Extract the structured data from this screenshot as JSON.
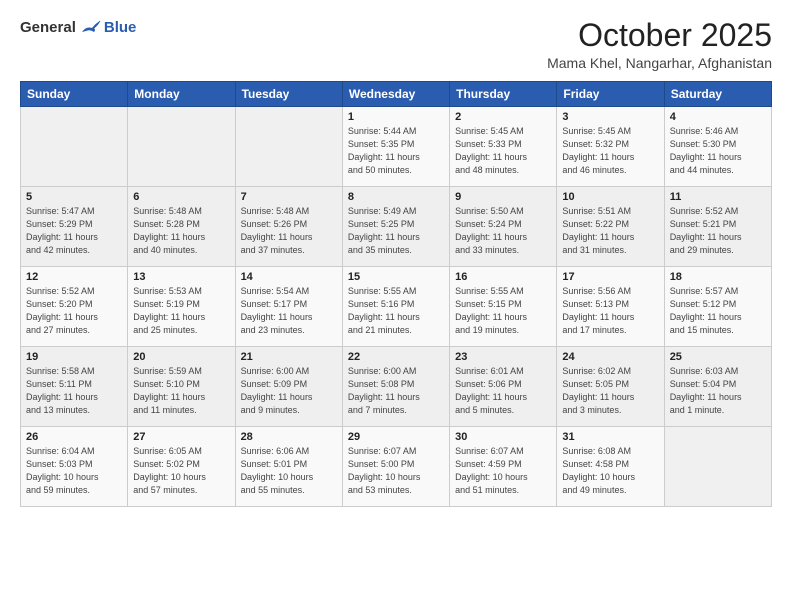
{
  "header": {
    "logo": {
      "general": "General",
      "blue": "Blue"
    },
    "title": "October 2025",
    "location": "Mama Khel, Nangarhar, Afghanistan"
  },
  "weekdays": [
    "Sunday",
    "Monday",
    "Tuesday",
    "Wednesday",
    "Thursday",
    "Friday",
    "Saturday"
  ],
  "weeks": [
    [
      {
        "day": "",
        "info": ""
      },
      {
        "day": "",
        "info": ""
      },
      {
        "day": "",
        "info": ""
      },
      {
        "day": "1",
        "info": "Sunrise: 5:44 AM\nSunset: 5:35 PM\nDaylight: 11 hours\nand 50 minutes."
      },
      {
        "day": "2",
        "info": "Sunrise: 5:45 AM\nSunset: 5:33 PM\nDaylight: 11 hours\nand 48 minutes."
      },
      {
        "day": "3",
        "info": "Sunrise: 5:45 AM\nSunset: 5:32 PM\nDaylight: 11 hours\nand 46 minutes."
      },
      {
        "day": "4",
        "info": "Sunrise: 5:46 AM\nSunset: 5:30 PM\nDaylight: 11 hours\nand 44 minutes."
      }
    ],
    [
      {
        "day": "5",
        "info": "Sunrise: 5:47 AM\nSunset: 5:29 PM\nDaylight: 11 hours\nand 42 minutes."
      },
      {
        "day": "6",
        "info": "Sunrise: 5:48 AM\nSunset: 5:28 PM\nDaylight: 11 hours\nand 40 minutes."
      },
      {
        "day": "7",
        "info": "Sunrise: 5:48 AM\nSunset: 5:26 PM\nDaylight: 11 hours\nand 37 minutes."
      },
      {
        "day": "8",
        "info": "Sunrise: 5:49 AM\nSunset: 5:25 PM\nDaylight: 11 hours\nand 35 minutes."
      },
      {
        "day": "9",
        "info": "Sunrise: 5:50 AM\nSunset: 5:24 PM\nDaylight: 11 hours\nand 33 minutes."
      },
      {
        "day": "10",
        "info": "Sunrise: 5:51 AM\nSunset: 5:22 PM\nDaylight: 11 hours\nand 31 minutes."
      },
      {
        "day": "11",
        "info": "Sunrise: 5:52 AM\nSunset: 5:21 PM\nDaylight: 11 hours\nand 29 minutes."
      }
    ],
    [
      {
        "day": "12",
        "info": "Sunrise: 5:52 AM\nSunset: 5:20 PM\nDaylight: 11 hours\nand 27 minutes."
      },
      {
        "day": "13",
        "info": "Sunrise: 5:53 AM\nSunset: 5:19 PM\nDaylight: 11 hours\nand 25 minutes."
      },
      {
        "day": "14",
        "info": "Sunrise: 5:54 AM\nSunset: 5:17 PM\nDaylight: 11 hours\nand 23 minutes."
      },
      {
        "day": "15",
        "info": "Sunrise: 5:55 AM\nSunset: 5:16 PM\nDaylight: 11 hours\nand 21 minutes."
      },
      {
        "day": "16",
        "info": "Sunrise: 5:55 AM\nSunset: 5:15 PM\nDaylight: 11 hours\nand 19 minutes."
      },
      {
        "day": "17",
        "info": "Sunrise: 5:56 AM\nSunset: 5:13 PM\nDaylight: 11 hours\nand 17 minutes."
      },
      {
        "day": "18",
        "info": "Sunrise: 5:57 AM\nSunset: 5:12 PM\nDaylight: 11 hours\nand 15 minutes."
      }
    ],
    [
      {
        "day": "19",
        "info": "Sunrise: 5:58 AM\nSunset: 5:11 PM\nDaylight: 11 hours\nand 13 minutes."
      },
      {
        "day": "20",
        "info": "Sunrise: 5:59 AM\nSunset: 5:10 PM\nDaylight: 11 hours\nand 11 minutes."
      },
      {
        "day": "21",
        "info": "Sunrise: 6:00 AM\nSunset: 5:09 PM\nDaylight: 11 hours\nand 9 minutes."
      },
      {
        "day": "22",
        "info": "Sunrise: 6:00 AM\nSunset: 5:08 PM\nDaylight: 11 hours\nand 7 minutes."
      },
      {
        "day": "23",
        "info": "Sunrise: 6:01 AM\nSunset: 5:06 PM\nDaylight: 11 hours\nand 5 minutes."
      },
      {
        "day": "24",
        "info": "Sunrise: 6:02 AM\nSunset: 5:05 PM\nDaylight: 11 hours\nand 3 minutes."
      },
      {
        "day": "25",
        "info": "Sunrise: 6:03 AM\nSunset: 5:04 PM\nDaylight: 11 hours\nand 1 minute."
      }
    ],
    [
      {
        "day": "26",
        "info": "Sunrise: 6:04 AM\nSunset: 5:03 PM\nDaylight: 10 hours\nand 59 minutes."
      },
      {
        "day": "27",
        "info": "Sunrise: 6:05 AM\nSunset: 5:02 PM\nDaylight: 10 hours\nand 57 minutes."
      },
      {
        "day": "28",
        "info": "Sunrise: 6:06 AM\nSunset: 5:01 PM\nDaylight: 10 hours\nand 55 minutes."
      },
      {
        "day": "29",
        "info": "Sunrise: 6:07 AM\nSunset: 5:00 PM\nDaylight: 10 hours\nand 53 minutes."
      },
      {
        "day": "30",
        "info": "Sunrise: 6:07 AM\nSunset: 4:59 PM\nDaylight: 10 hours\nand 51 minutes."
      },
      {
        "day": "31",
        "info": "Sunrise: 6:08 AM\nSunset: 4:58 PM\nDaylight: 10 hours\nand 49 minutes."
      },
      {
        "day": "",
        "info": ""
      }
    ]
  ]
}
